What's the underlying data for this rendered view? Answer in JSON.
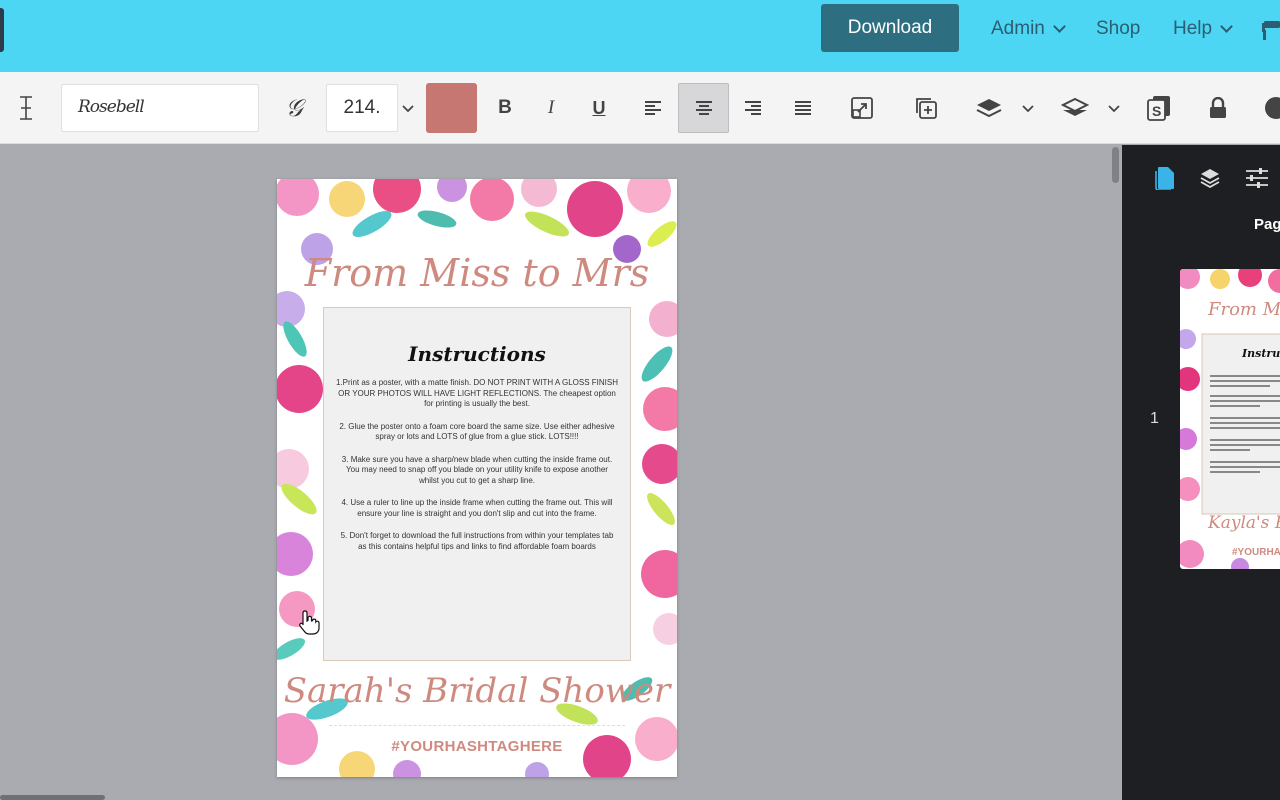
{
  "topbar": {
    "download_label": "Download",
    "nav": [
      {
        "label": "Admin",
        "has_dropdown": true
      },
      {
        "label": "Shop",
        "has_dropdown": false
      },
      {
        "label": "Help",
        "has_dropdown": true
      }
    ]
  },
  "toolbar": {
    "font_name": "Rosebell",
    "font_size": "214.",
    "text_color": "#c77771",
    "align_active": "center"
  },
  "document": {
    "header_script": "From Miss to Mrs",
    "instructions_heading": "Instructions",
    "instructions": [
      "1.Print as a poster, with a matte finish. DO NOT PRINT WITH A GLOSS FINISH OR YOUR PHOTOS WILL HAVE LIGHT REFLECTIONS. The cheapest option for printing is usually the best.",
      "2. Glue the poster onto a foam core board the same size. Use either adhesive spray or lots and LOTS of glue from a glue stick. LOTS!!!!",
      "3. Make sure you have a sharp/new blade when cutting the inside frame out. You may need to snap off you blade on your utility knife to expose another whilst you cut to get a sharp line.",
      "4. Use a ruler to line up the inside frame when cutting the frame out. This will ensure your line is straight and you don't slip and cut into the frame.",
      "5. Don't forget to download the full instructions from within your templates tab as this contains helpful tips and links to find affordable foam boards"
    ],
    "footer_script": "Sarah's Bridal Shower",
    "hashtag": "#YOURHASHTAGHERE"
  },
  "right_panel": {
    "tab_label": "Pag",
    "page_number": "1",
    "thumb_header": "From Mi",
    "thumb_heading": "Instru",
    "thumb_footer": "Kayla's Bri",
    "thumb_hashtag": "#YOURHAS"
  },
  "colors": {
    "topbar": "#4dd6f4",
    "download_button": "#2d6f80",
    "accent_script": "#cf8a80",
    "panel_dark": "#1d1f22",
    "panel_icon_active": "#3ab4e8"
  }
}
